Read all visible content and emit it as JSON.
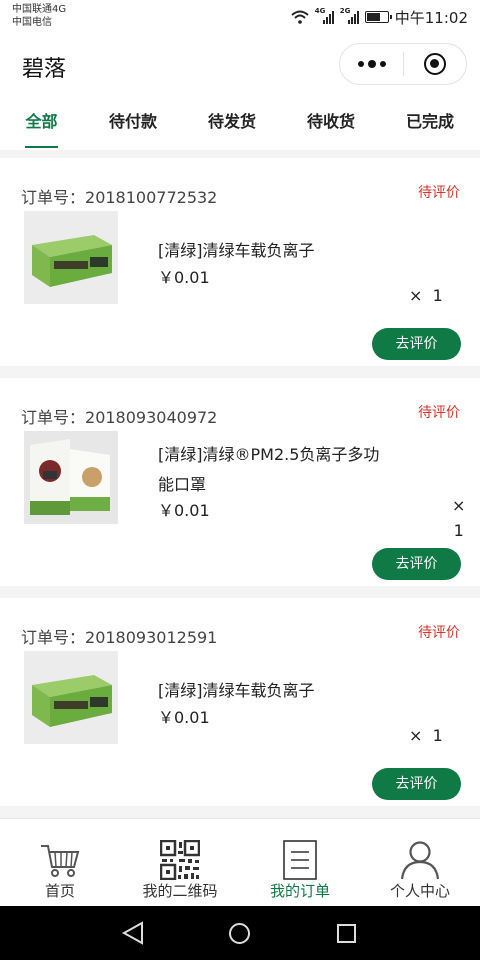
{
  "status_bar": {
    "carrier_line1": "中国联通4G",
    "carrier_line2": "中国电信",
    "net1": "4G",
    "net2": "2G",
    "time": "中午11:02"
  },
  "navbar": {
    "title": "碧落"
  },
  "tabs": [
    {
      "label": "全部",
      "active": true
    },
    {
      "label": "待付款",
      "active": false
    },
    {
      "label": "待发货",
      "active": false
    },
    {
      "label": "待收货",
      "active": false
    },
    {
      "label": "已完成",
      "active": false
    }
  ],
  "orders": [
    {
      "order_label": "订单号：",
      "order_no": "2018100772532",
      "status": "待评价",
      "product_name": "[清绿]清绿车载负离子",
      "price": "￥0.01",
      "qty_symbol": "×",
      "qty": "1",
      "action": "去评价"
    },
    {
      "order_label": "订单号：",
      "order_no": "2018093040972",
      "status": "待评价",
      "product_name": "[清绿]清绿®PM2.5负离子多功能口罩",
      "price": "￥0.01",
      "qty_symbol": "×",
      "qty": "1",
      "action": "去评价"
    },
    {
      "order_label": "订单号：",
      "order_no": "2018093012591",
      "status": "待评价",
      "product_name": "[清绿]清绿车载负离子",
      "price": "￥0.01",
      "qty_symbol": "×",
      "qty": "1",
      "action": "去评价"
    }
  ],
  "tabbar": [
    {
      "label": "首页",
      "icon": "cart-icon",
      "active": false
    },
    {
      "label": "我的二维码",
      "icon": "qr-code-icon",
      "active": false
    },
    {
      "label": "我的订单",
      "icon": "order-list-icon",
      "active": true
    },
    {
      "label": "个人中心",
      "icon": "person-icon",
      "active": false
    }
  ],
  "colors": {
    "accent": "#0f7a46",
    "status_red": "#e0322b"
  }
}
